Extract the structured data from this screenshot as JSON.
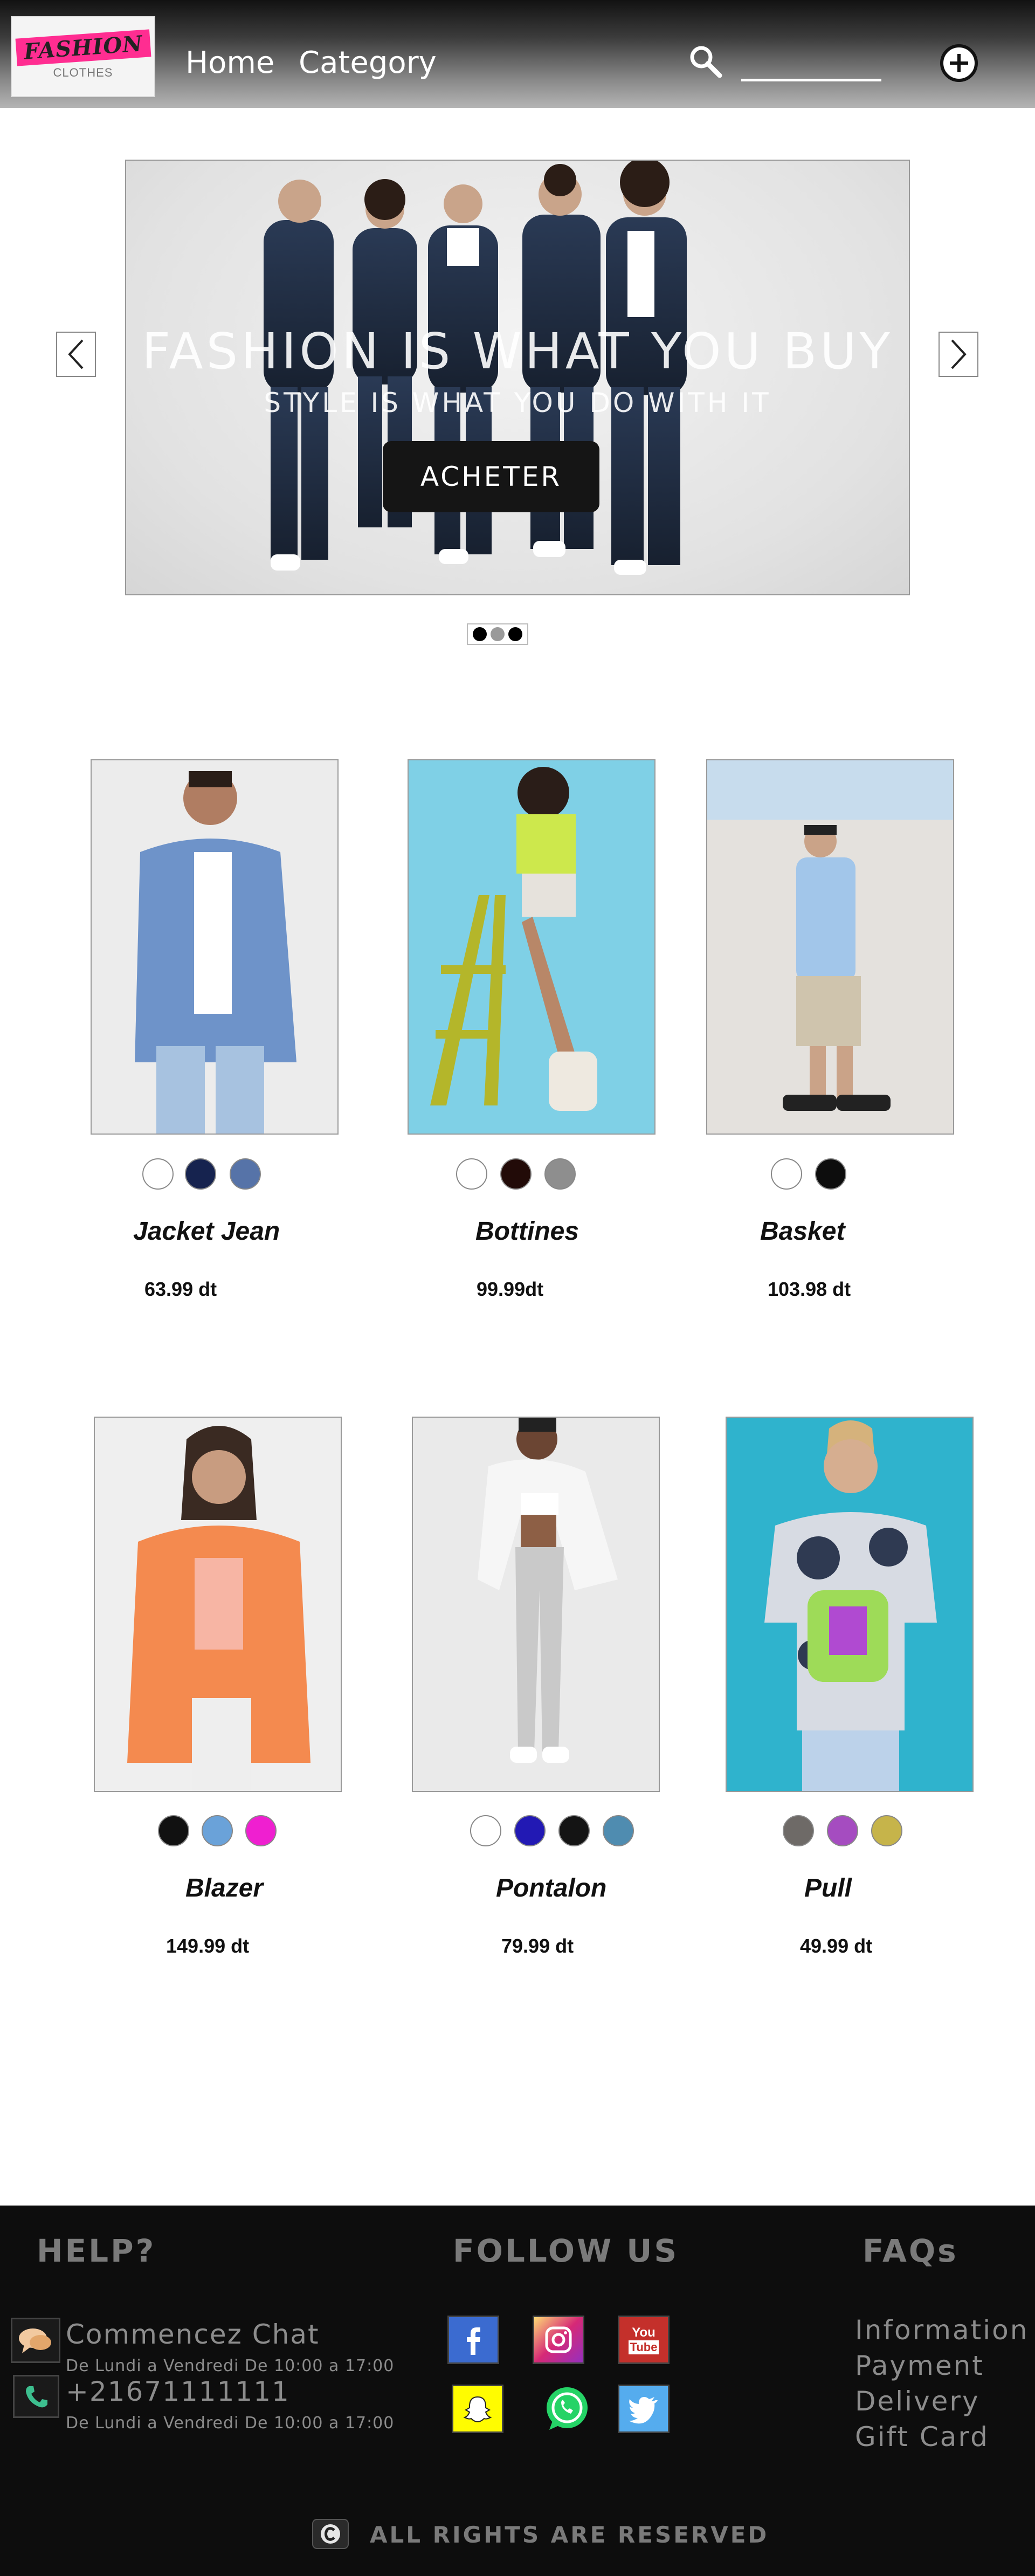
{
  "header": {
    "logo_main": "FASHION",
    "logo_sub": "CLOTHES",
    "nav": [
      {
        "label": "Home"
      },
      {
        "label": "Category"
      }
    ],
    "search_value": ""
  },
  "hero": {
    "title": "FASHION IS WHAT YOU BUY",
    "subtitle": "STYLE IS WHAT YOU DO WITH IT",
    "button_label": "ACHETER",
    "active_slide": 2,
    "slide_count": 3
  },
  "products": [
    {
      "name": "Jacket Jean",
      "price": "63.99 dt",
      "colors": [
        "#ffffff",
        "#16234f",
        "#5673a8"
      ]
    },
    {
      "name": "Bottines",
      "price": "99.99dt",
      "colors": [
        "#ffffff",
        "#220b08",
        "#8e8e8e"
      ]
    },
    {
      "name": "Basket",
      "price": "103.98 dt",
      "colors": [
        "#ffffff",
        "#0d0d0d"
      ]
    },
    {
      "name": "Blazer",
      "price": "149.99 dt",
      "colors": [
        "#111111",
        "#6aa2d9",
        "#ef1fd0"
      ]
    },
    {
      "name": "Pontalon",
      "price": "79.99 dt",
      "colors": [
        "#ffffff",
        "#2219b4",
        "#141414",
        "#4f8cb0"
      ]
    },
    {
      "name": "Pull",
      "price": "49.99 dt",
      "colors": [
        "#6e6a67",
        "#a54cc0",
        "#c6b44a"
      ]
    }
  ],
  "footer": {
    "help_title": "HELP?",
    "chat_label": "Commencez Chat",
    "chat_hours": "De Lundi a Vendredi De 10:00 a 17:00",
    "phone": "+21671111111",
    "phone_hours": "De Lundi a Vendredi De 10:00 a 17:00",
    "follow_title": "FOLLOW US",
    "social": [
      "facebook-icon",
      "instagram-icon",
      "youtube-icon",
      "snapchat-icon",
      "whatsapp-icon",
      "twitter-icon"
    ],
    "youtube_text_1": "You",
    "youtube_text_2": "Tube",
    "faq_title": "FAQs",
    "faq_links": [
      "Information",
      "Payment",
      "Delivery",
      "Gift Card"
    ],
    "copyright": "ALL RIGHTS ARE RESERVED"
  },
  "colors": {
    "accent_pink": "#ff2d91",
    "footer_bg": "#0d0d0d",
    "button_bg": "#151515"
  }
}
